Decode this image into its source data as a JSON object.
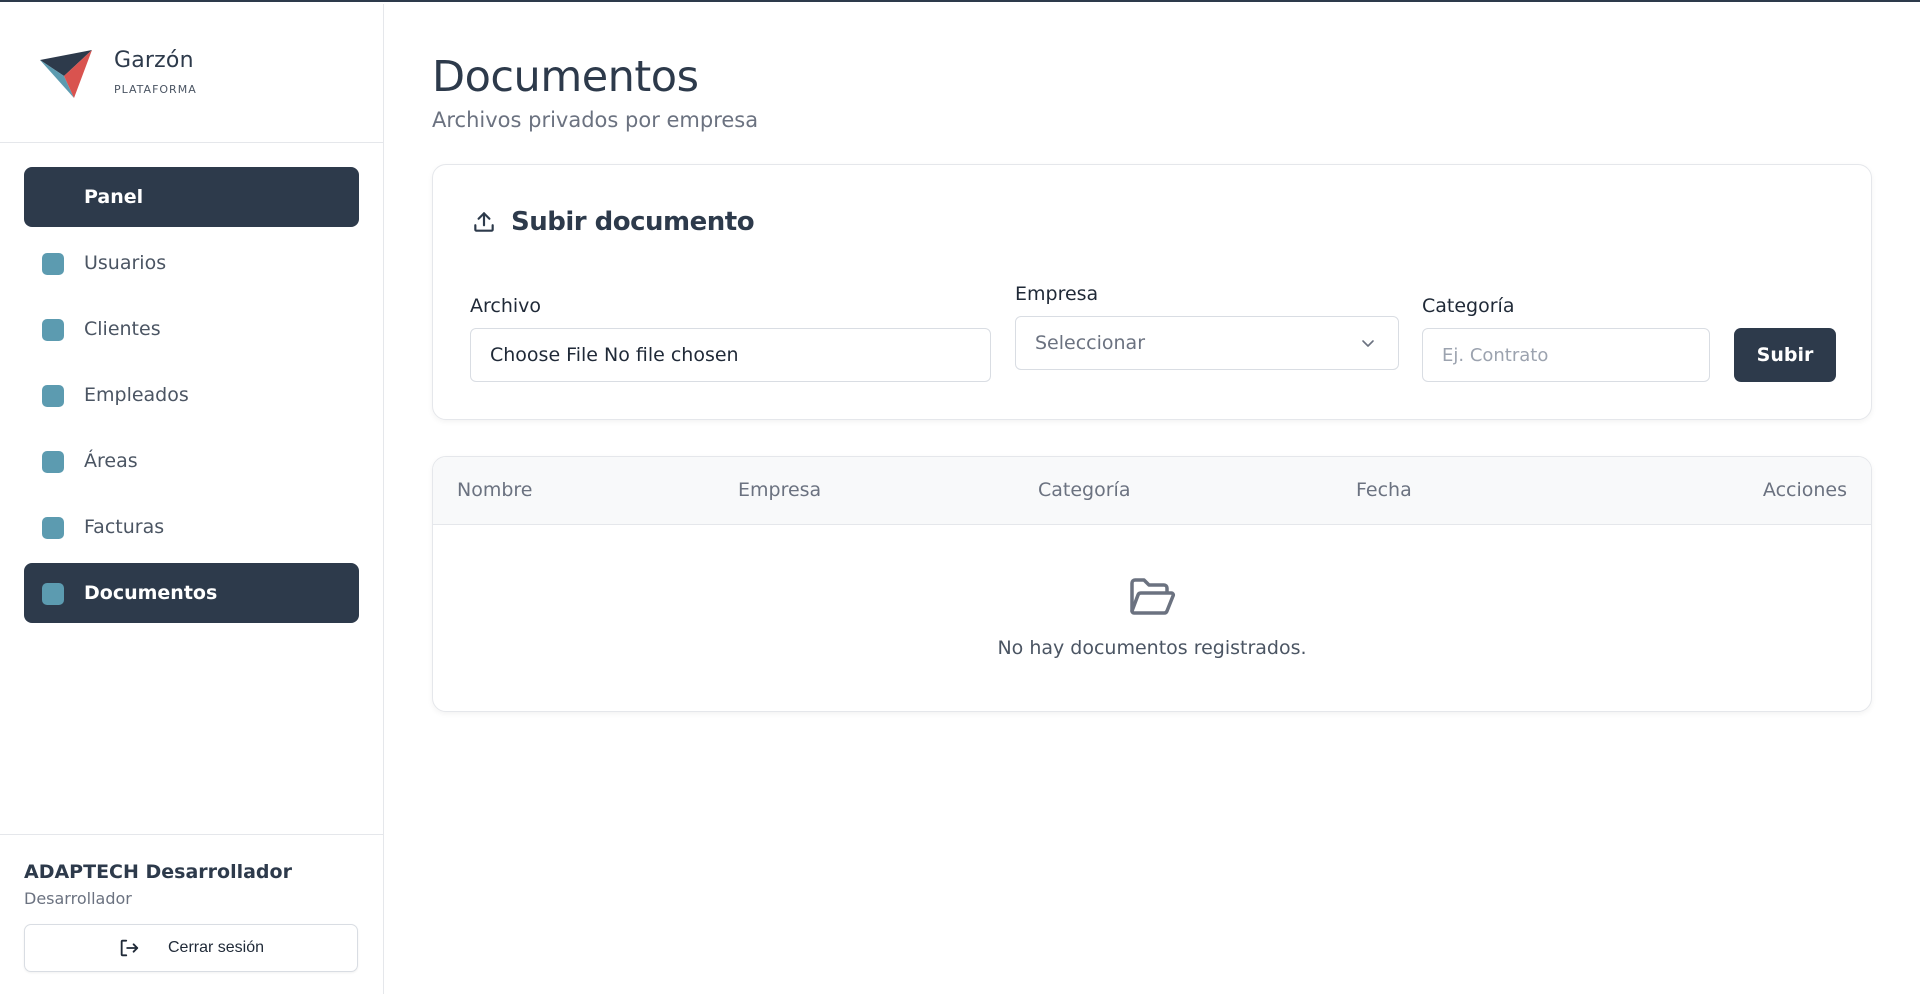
{
  "brand": {
    "name": "Garzón",
    "subtitle": "PLATAFORMA"
  },
  "sidebar": {
    "items": [
      {
        "label": "Panel",
        "active": true
      },
      {
        "label": "Usuarios",
        "active": false
      },
      {
        "label": "Clientes",
        "active": false
      },
      {
        "label": "Empleados",
        "active": false
      },
      {
        "label": "Áreas",
        "active": false
      },
      {
        "label": "Facturas",
        "active": false
      },
      {
        "label": "Documentos",
        "active": true
      }
    ]
  },
  "user": {
    "name": "ADAPTECH Desarrollador",
    "role": "Desarrollador",
    "logout_label": "Cerrar sesión"
  },
  "page": {
    "title": "Documentos",
    "subtitle": "Archivos privados por empresa"
  },
  "upload": {
    "heading": "Subir documento",
    "file_label": "Archivo",
    "file_button": "Choose File",
    "file_status": "No file chosen",
    "company_label": "Empresa",
    "company_selected": "Seleccionar",
    "category_label": "Categoría",
    "category_placeholder": "Ej. Contrato",
    "submit_label": "Subir"
  },
  "table": {
    "columns": [
      "Nombre",
      "Empresa",
      "Categoría",
      "Fecha",
      "Acciones"
    ],
    "empty_message": "No hay documentos registrados."
  },
  "colors": {
    "primary": "#2d3a4b",
    "accent": "#5c9bb0",
    "logo_red": "#d9534f"
  },
  "icons": {
    "upload": "upload-icon",
    "folder": "folder-open-icon",
    "logout": "logout-icon",
    "chevron": "chevron-down-icon"
  }
}
